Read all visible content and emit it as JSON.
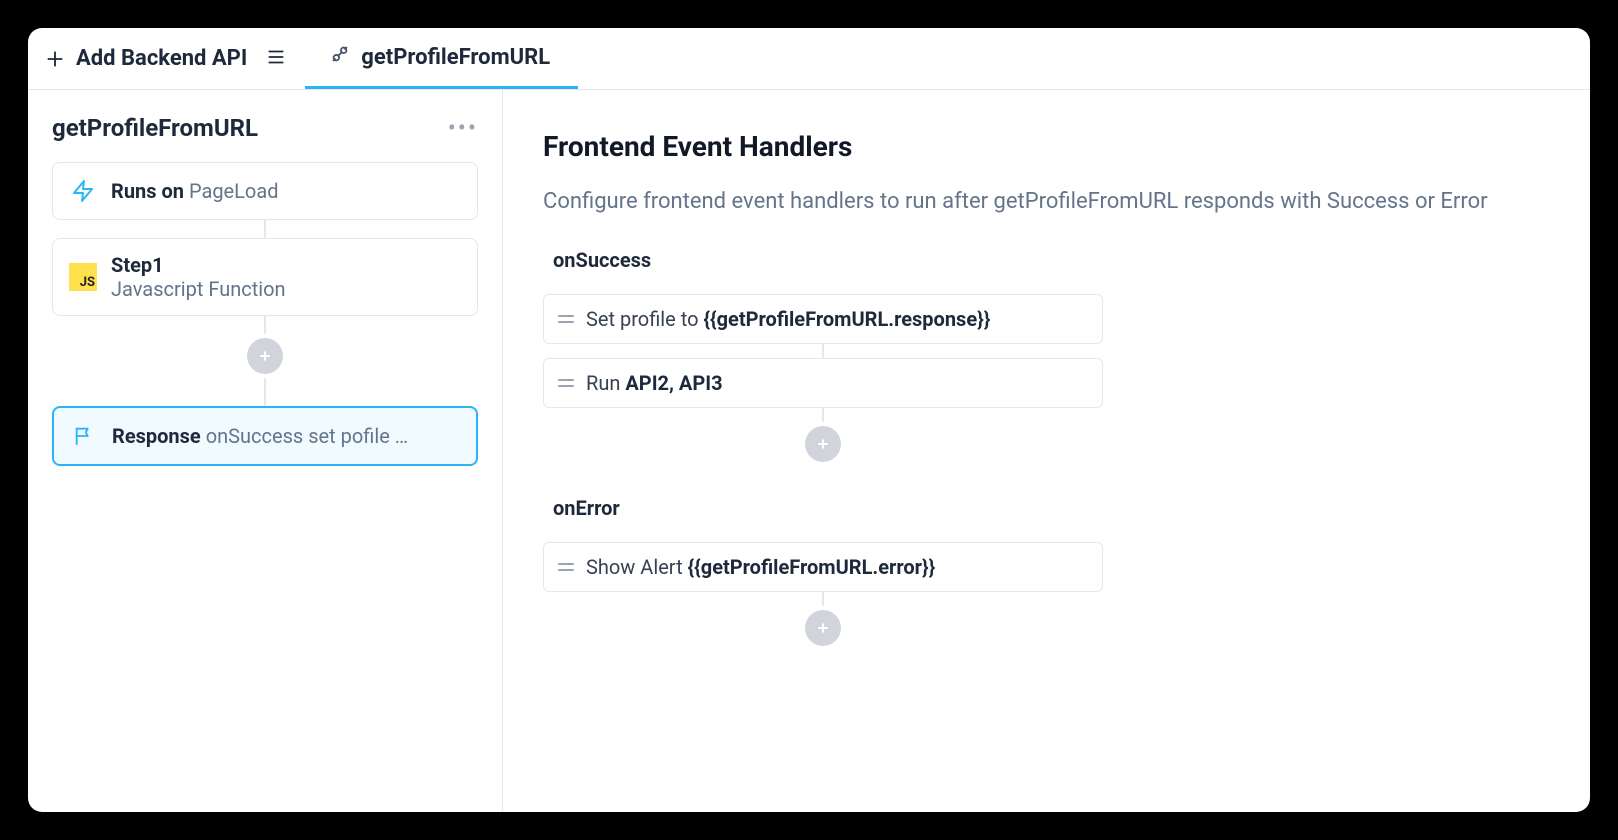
{
  "toolbar": {
    "add_backend_api_label": "Add Backend API",
    "tab_label": "getProfileFromURL"
  },
  "sidebar": {
    "title": "getProfileFromURL",
    "trigger": {
      "label": "Runs on",
      "value": "PageLoad"
    },
    "step1": {
      "title": "Step1",
      "subtitle": "Javascript Function"
    },
    "response": {
      "label": "Response",
      "summary": "onSuccess set pofile …"
    }
  },
  "main": {
    "heading": "Frontend Event Handlers",
    "description": "Configure frontend event handlers to run after getProfileFromURL responds with Success or Error",
    "onSuccess": {
      "label": "onSuccess",
      "handlers": [
        {
          "prefix": "Set profile to ",
          "bold": "{{getProfileFromURL.response}}",
          "suffix": ""
        },
        {
          "prefix": "Run ",
          "bold": "API2, API3",
          "suffix": ""
        }
      ]
    },
    "onError": {
      "label": "onError",
      "handlers": [
        {
          "prefix": "Show Alert ",
          "bold": "{{getProfileFromURL.error}}",
          "suffix": ""
        }
      ]
    }
  }
}
